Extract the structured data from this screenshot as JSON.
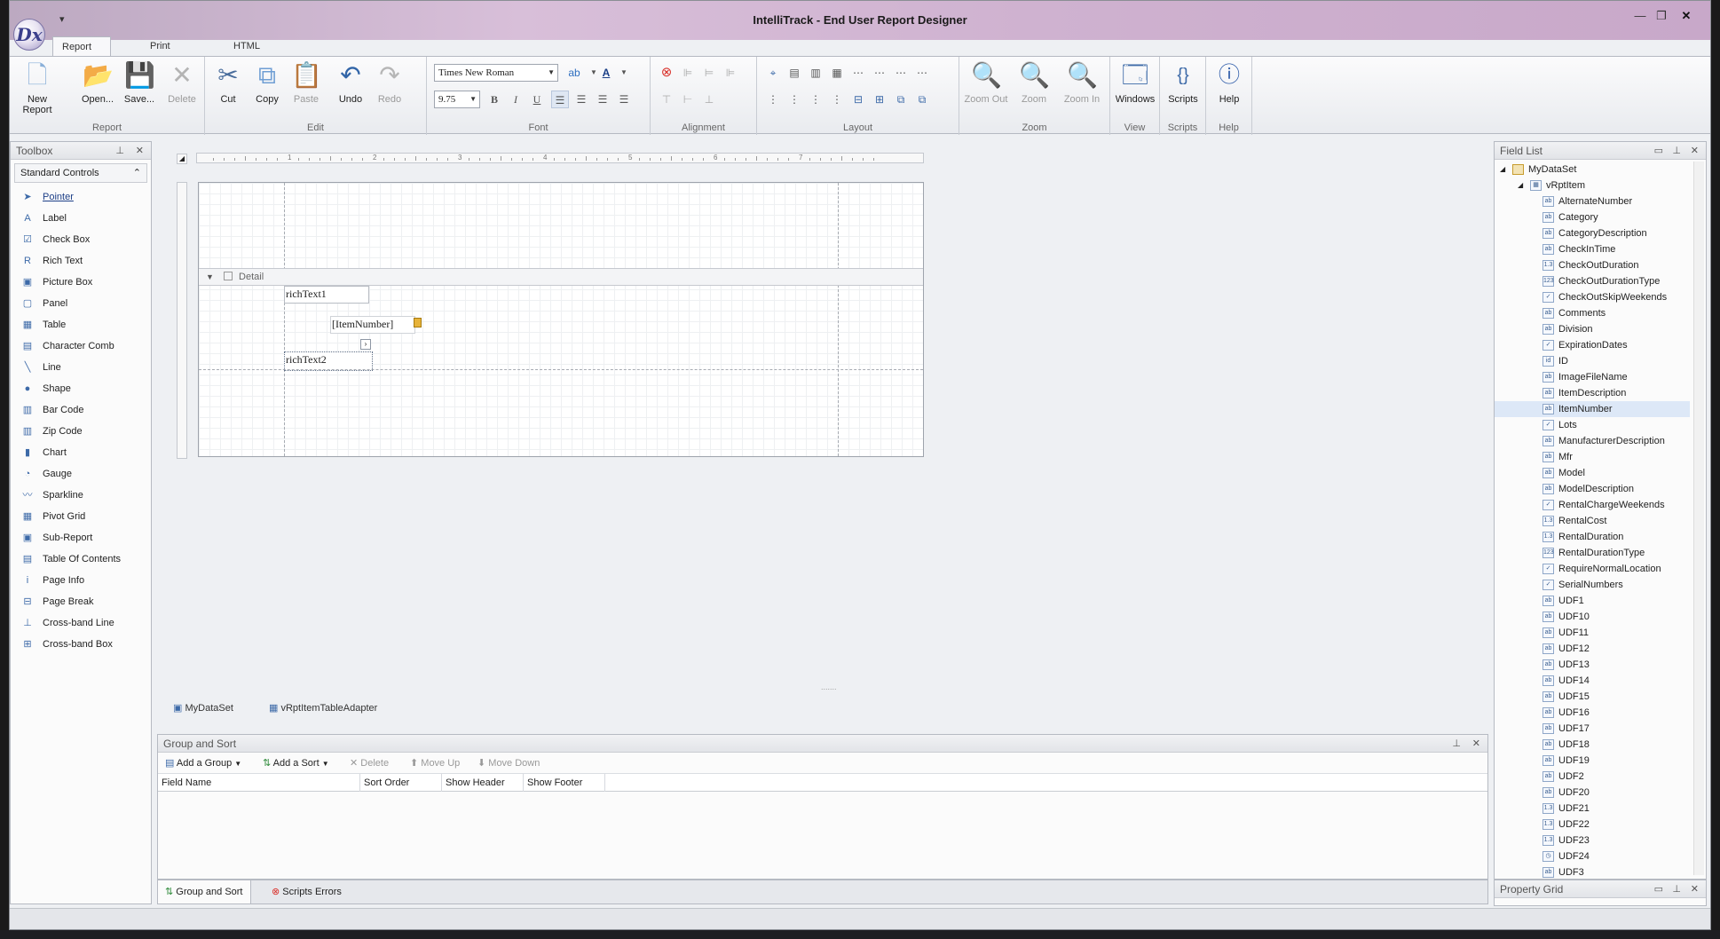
{
  "window": {
    "title": "IntelliTrack - End User Report Designer",
    "logo": "Dx",
    "qat": "▾"
  },
  "tabs": [
    "Report Designer",
    "Print Preview",
    "HTML View"
  ],
  "ribbon": {
    "groups": [
      "Report",
      "Edit",
      "Font",
      "Alignment",
      "Layout",
      "Zoom",
      "View",
      "Scripts",
      "Help"
    ],
    "report": [
      "New Report",
      "Open...",
      "Save...",
      "Delete"
    ],
    "edit": [
      "Cut",
      "Copy",
      "Paste",
      "Undo",
      "Redo"
    ],
    "font": {
      "name": "Times New Roman",
      "size": "9.75"
    },
    "zoom": [
      "Zoom Out",
      "Zoom",
      "Zoom In"
    ],
    "view": "Windows",
    "scripts": "Scripts",
    "help": "Help"
  },
  "toolbox": {
    "title": "Toolbox",
    "category": "Standard Controls",
    "items": [
      "Pointer",
      "Label",
      "Check Box",
      "Rich Text",
      "Picture Box",
      "Panel",
      "Table",
      "Character Comb",
      "Line",
      "Shape",
      "Bar Code",
      "Zip Code",
      "Chart",
      "Gauge",
      "Sparkline",
      "Pivot Grid",
      "Sub-Report",
      "Table Of Contents",
      "Page Info",
      "Page Break",
      "Cross-band Line",
      "Cross-band Box"
    ]
  },
  "designer": {
    "band": "Detail",
    "controls": [
      "richText1",
      "[ItemNumber]",
      "richText2"
    ],
    "components": [
      "MyDataSet",
      "vRptItemTableAdapter"
    ],
    "ruler": [
      "1",
      "2",
      "3",
      "4",
      "5",
      "6",
      "7"
    ]
  },
  "fieldlist": {
    "title": "Field List",
    "root": "MyDataSet",
    "table": "vRptItem",
    "selected": "ItemNumber",
    "fields": [
      {
        "name": "AlternateNumber",
        "t": "ab"
      },
      {
        "name": "Category",
        "t": "ab"
      },
      {
        "name": "CategoryDescription",
        "t": "ab"
      },
      {
        "name": "CheckInTime",
        "t": "ab"
      },
      {
        "name": "CheckOutDuration",
        "t": "1.3"
      },
      {
        "name": "CheckOutDurationType",
        "t": "123"
      },
      {
        "name": "CheckOutSkipWeekends",
        "t": "✓"
      },
      {
        "name": "Comments",
        "t": "ab"
      },
      {
        "name": "Division",
        "t": "ab"
      },
      {
        "name": "ExpirationDates",
        "t": "✓"
      },
      {
        "name": "ID",
        "t": "id"
      },
      {
        "name": "ImageFileName",
        "t": "ab"
      },
      {
        "name": "ItemDescription",
        "t": "ab"
      },
      {
        "name": "ItemNumber",
        "t": "ab"
      },
      {
        "name": "Lots",
        "t": "✓"
      },
      {
        "name": "ManufacturerDescription",
        "t": "ab"
      },
      {
        "name": "Mfr",
        "t": "ab"
      },
      {
        "name": "Model",
        "t": "ab"
      },
      {
        "name": "ModelDescription",
        "t": "ab"
      },
      {
        "name": "RentalChargeWeekends",
        "t": "✓"
      },
      {
        "name": "RentalCost",
        "t": "1.3"
      },
      {
        "name": "RentalDuration",
        "t": "1.3"
      },
      {
        "name": "RentalDurationType",
        "t": "123"
      },
      {
        "name": "RequireNormalLocation",
        "t": "✓"
      },
      {
        "name": "SerialNumbers",
        "t": "✓"
      },
      {
        "name": "UDF1",
        "t": "ab"
      },
      {
        "name": "UDF10",
        "t": "ab"
      },
      {
        "name": "UDF11",
        "t": "ab"
      },
      {
        "name": "UDF12",
        "t": "ab"
      },
      {
        "name": "UDF13",
        "t": "ab"
      },
      {
        "name": "UDF14",
        "t": "ab"
      },
      {
        "name": "UDF15",
        "t": "ab"
      },
      {
        "name": "UDF16",
        "t": "ab"
      },
      {
        "name": "UDF17",
        "t": "ab"
      },
      {
        "name": "UDF18",
        "t": "ab"
      },
      {
        "name": "UDF19",
        "t": "ab"
      },
      {
        "name": "UDF2",
        "t": "ab"
      },
      {
        "name": "UDF20",
        "t": "ab"
      },
      {
        "name": "UDF21",
        "t": "1.3"
      },
      {
        "name": "UDF22",
        "t": "1.3"
      },
      {
        "name": "UDF23",
        "t": "1.3"
      },
      {
        "name": "UDF24",
        "t": "◷"
      },
      {
        "name": "UDF3",
        "t": "ab"
      }
    ]
  },
  "propgrid": {
    "title": "Property Grid"
  },
  "groupsort": {
    "title": "Group and Sort",
    "buttons": [
      "Add a Group",
      "Add a Sort",
      "Delete",
      "Move Up",
      "Move Down"
    ],
    "columns": [
      "Field Name",
      "Sort Order",
      "Show Header",
      "Show Footer"
    ]
  },
  "bottomtabs": [
    "Group and Sort",
    "Scripts Errors"
  ],
  "colors": {
    "accent": "#3d6aa8",
    "selection": "#dde8f7",
    "error": "#d9302a"
  }
}
